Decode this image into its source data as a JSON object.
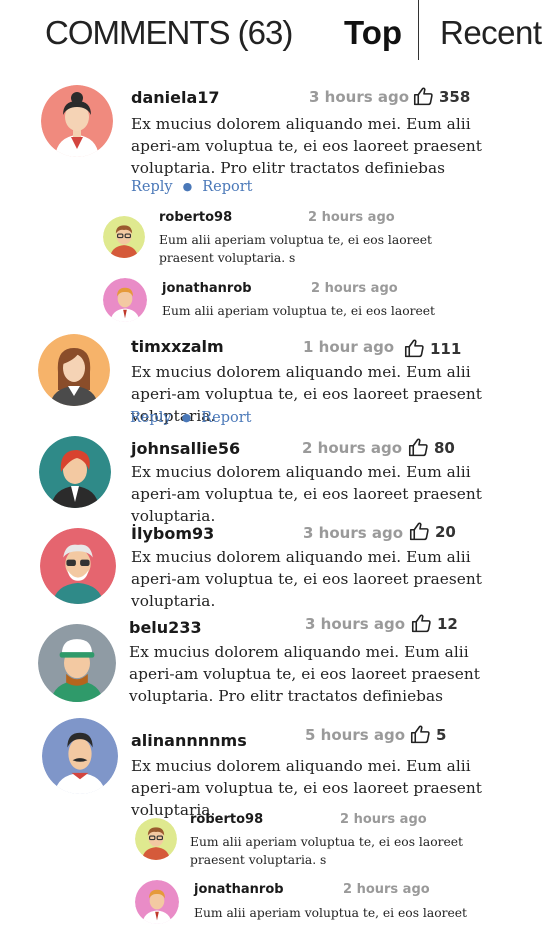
{
  "header": {
    "title": "COMMENTS (63)",
    "tab_top": "Top",
    "tab_recent": "Recent"
  },
  "actions": {
    "reply": "Reply",
    "report": "Report"
  },
  "comments": [
    {
      "username": "daniela17",
      "time": "3 hours ago",
      "likes": "358",
      "text": "Ex mucius dolorem aliquando mei. Eum alii aperi-am voluptua te, ei eos laoreet praesent voluptaria. Pro elitr tractatos definiebas"
    },
    {
      "username": "roberto98",
      "time": "2 hours ago",
      "text": "Eum alii aperiam voluptua te, ei eos laoreet praesent voluptaria. s"
    },
    {
      "username": "jonathanrob",
      "time": "2 hours ago",
      "text": "Eum alii aperiam voluptua te, ei eos laoreet"
    },
    {
      "username": "timxxzalm",
      "time": "1 hour ago",
      "likes": "111",
      "text": "Ex mucius dolorem aliquando mei. Eum alii aperi-am voluptua te, ei eos laoreet praesent voluptaria."
    },
    {
      "username": "johnsallie56",
      "time": "2 hours ago",
      "likes": "80",
      "text": "Ex mucius dolorem aliquando mei. Eum alii aperi-am voluptua te, ei eos laoreet praesent voluptaria."
    },
    {
      "username": "İlybom93",
      "time": "3 hours ago",
      "likes": "20",
      "text": "Ex mucius dolorem aliquando mei. Eum alii aperi-am voluptua te, ei eos laoreet praesent voluptaria."
    },
    {
      "username": "belu233",
      "time": "3 hours ago",
      "likes": "12",
      "text": "Ex mucius dolorem aliquando mei. Eum alii aperi-am voluptua te, ei eos laoreet praesent voluptaria. Pro elitr tractatos definiebas"
    },
    {
      "username": "alinannnnms",
      "time": "5 hours ago",
      "likes": "5",
      "text": "Ex mucius dolorem aliquando mei. Eum alii aperi-am voluptua te, ei eos laoreet praesent voluptaria."
    },
    {
      "username": "roberto98",
      "time": "2 hours ago",
      "text": "Eum alii aperiam voluptua te, ei eos laoreet praesent voluptaria. s"
    },
    {
      "username": "jonathanrob",
      "time": "2 hours ago",
      "text": "Eum alii aperiam voluptua te, ei eos laoreet"
    }
  ],
  "colors": {
    "link": "#4a78b8",
    "time": "#9a9a9a",
    "avatar_bg": [
      "#f08a7e",
      "#dfe98f",
      "#e98cc7",
      "#f6b36a",
      "#2f8a88",
      "#e5656f",
      "#8f9ba4",
      "#7f96c9"
    ]
  },
  "icons": [
    "thumbs-up-icon",
    "avatar-illustration"
  ]
}
